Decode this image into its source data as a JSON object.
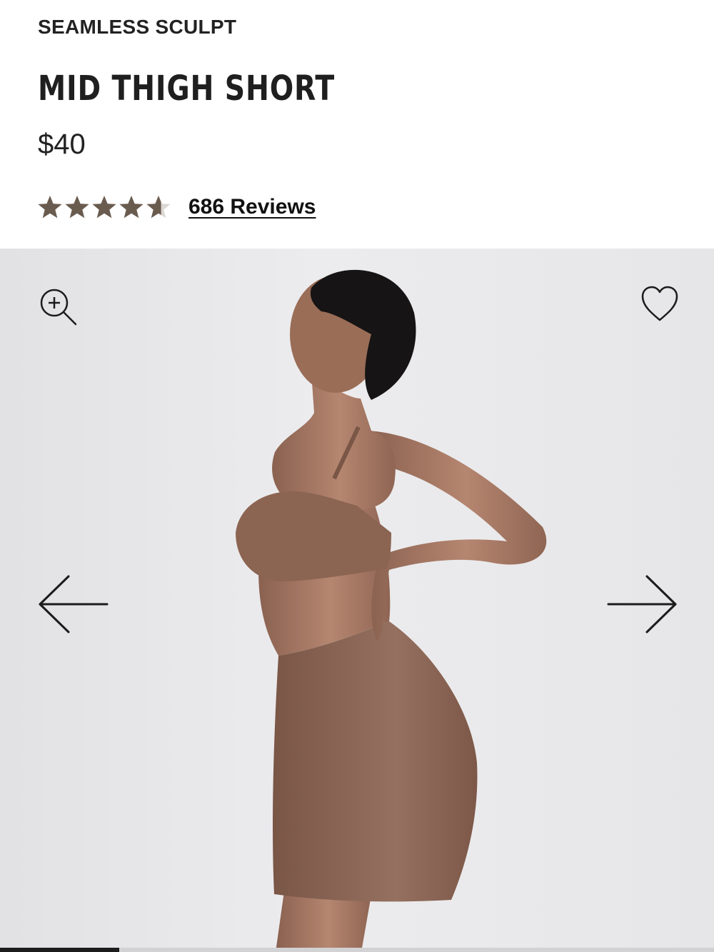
{
  "product": {
    "collection": "SEAMLESS SCULPT",
    "title": "MID THIGH SHORT",
    "price": "$40",
    "rating": 4.6,
    "reviews_label": "686 Reviews"
  },
  "gallery": {
    "current_slide_fraction": 0.167
  },
  "icons": {
    "zoom": "zoom-in-icon",
    "favorite": "heart-icon",
    "previous": "arrow-left-icon",
    "next": "arrow-right-icon",
    "rating_star": "star-icon"
  },
  "colors": {
    "star_fill": "#6a5b4f",
    "star_empty": "#dcd8d4",
    "garment": "#8a6350",
    "background": "#e8e8ea",
    "progress_fill": "#1c1c1c",
    "text": "#1c1c1c"
  }
}
